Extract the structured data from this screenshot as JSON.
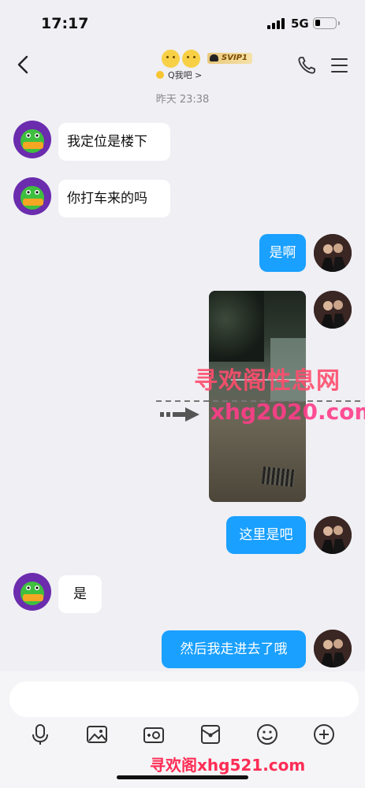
{
  "status_bar": {
    "time": "17:17",
    "network": "5G",
    "icons": [
      "signal-icon",
      "battery-icon"
    ]
  },
  "header": {
    "back_icon": "chevron-left-icon",
    "emoji_icons": [
      "smiley-face-icon",
      "smiley-face-icon"
    ],
    "badge": "SVIP1",
    "subtitle": "Q我吧 >",
    "right_icons": [
      "phone-icon",
      "menu-icon"
    ]
  },
  "chat": {
    "timestamp": "昨天 23:38",
    "messages": [
      {
        "side": "in",
        "text": "我定位是楼下"
      },
      {
        "side": "in",
        "text": "你打车来的吗"
      },
      {
        "side": "out",
        "text": "是啊"
      },
      {
        "side": "out",
        "type": "image"
      },
      {
        "side": "out",
        "text": "这里是吧"
      },
      {
        "side": "in",
        "text": "是"
      },
      {
        "side": "out",
        "text": "然后我走进去了哦"
      }
    ]
  },
  "watermarks": {
    "top": "寻欢阁性息网",
    "middle": "xhg2020.com",
    "bottom": "寻欢阁xhg521.com"
  },
  "input": {
    "placeholder": "",
    "toolbar": [
      "microphone-icon",
      "image-icon",
      "camera-icon",
      "red-packet-icon",
      "emoji-icon",
      "add-icon"
    ]
  },
  "colors": {
    "outgoing_bubble": "#1aa0ff",
    "incoming_bubble": "#ffffff",
    "background": "#efeff4",
    "watermark": "#ff4d6d"
  }
}
